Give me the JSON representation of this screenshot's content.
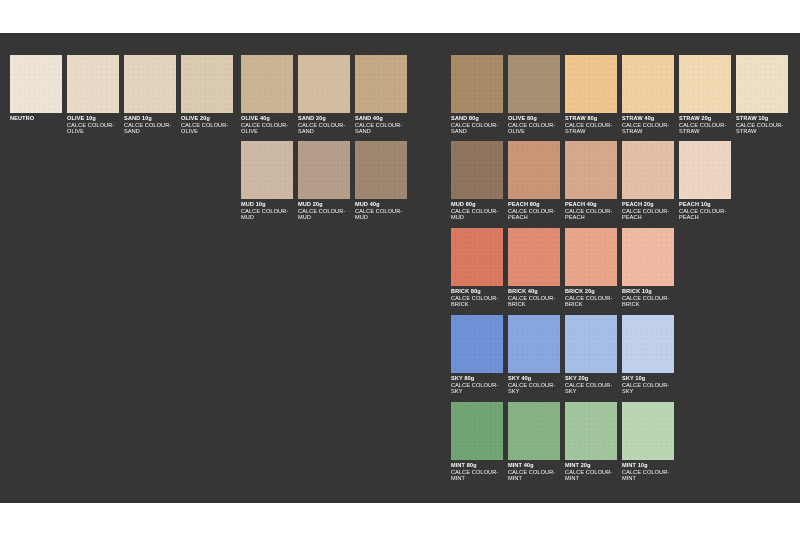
{
  "swatches_left": [
    {
      "title": "NEUTRO",
      "line2": "",
      "line3": "",
      "color": "#eee4d6"
    },
    {
      "title": "OLIVE 10g",
      "line2": "CALCE COLOUR-",
      "line3": "OLIVE",
      "color": "#e7dac6"
    },
    {
      "title": "SAND 10g",
      "line2": "CALCE COLOUR-",
      "line3": "SAND",
      "color": "#e3d3bf"
    },
    {
      "title": "OLIVE 20g",
      "line2": "CALCE COLOUR-",
      "line3": "OLIVE",
      "color": "#dacaaf"
    },
    {
      "title": "OLIVE 40g",
      "line2": "CALCE COLOUR-",
      "line3": "OLIVE",
      "color": "#c9b494"
    },
    {
      "title": "SAND 20g",
      "line2": "CALCE COLOUR-",
      "line3": "SAND",
      "color": "#d3bd9e"
    },
    {
      "title": "SAND 40g",
      "line2": "CALCE COLOUR-",
      "line3": "SAND",
      "color": "#c4a884"
    },
    {
      "title": "MUD 10g",
      "line2": "CALCE COLOUR-",
      "line3": "MUD",
      "color": "#ccb8a3"
    },
    {
      "title": "MUD 20g",
      "line2": "CALCE COLOUR-",
      "line3": "MUD",
      "color": "#b49e89"
    },
    {
      "title": "MUD 40g",
      "line2": "CALCE COLOUR-",
      "line3": "MUD",
      "color": "#9e8670"
    }
  ],
  "swatches_right": [
    {
      "title": "SAND 80g",
      "line2": "CALCE COLOUR-",
      "line3": "SAND",
      "color": "#a88965"
    },
    {
      "title": "OLIVE 80g",
      "line2": "CALCE COLOUR-",
      "line3": "OLIVE",
      "color": "#a69073"
    },
    {
      "title": "STRAW 80g",
      "line2": "CALCE COLOUR-",
      "line3": "STRAW",
      "color": "#efc58e"
    },
    {
      "title": "STRAW 40g",
      "line2": "CALCE COLOUR-",
      "line3": "STRAW",
      "color": "#f1cf9e"
    },
    {
      "title": "STRAW 20g",
      "line2": "CALCE COLOUR-",
      "line3": "STRAW",
      "color": "#f1d9b2"
    },
    {
      "title": "STRAW 10g",
      "line2": "CALCE COLOUR-",
      "line3": "STRAW",
      "color": "#ede0c6"
    },
    {
      "title": "MUD 80g",
      "line2": "CALCE COLOUR-",
      "line3": "MUD",
      "color": "#8e735d"
    },
    {
      "title": "PEACH 80g",
      "line2": "CALCE COLOUR-",
      "line3": "PEACH",
      "color": "#c99576"
    },
    {
      "title": "PEACH 40g",
      "line2": "CALCE COLOUR-",
      "line3": "PEACH",
      "color": "#d6a88b"
    },
    {
      "title": "PEACH 20g",
      "line2": "CALCE COLOUR-",
      "line3": "PEACH",
      "color": "#e3bfa5"
    },
    {
      "title": "PEACH 10g",
      "line2": "CALCE COLOUR-",
      "line3": "PEACH",
      "color": "#ecd5c2"
    },
    {
      "title": "BRICK 80g",
      "line2": "CALCE COLOUR-",
      "line3": "BRICK",
      "color": "#d9785e"
    },
    {
      "title": "BRICK 40g",
      "line2": "CALCE COLOUR-",
      "line3": "BRICK",
      "color": "#e08b70"
    },
    {
      "title": "BRICK 20g",
      "line2": "CALCE COLOUR-",
      "line3": "BRICK",
      "color": "#e9a388"
    },
    {
      "title": "BRICK 10g",
      "line2": "CALCE COLOUR-",
      "line3": "BRICK",
      "color": "#f0b9a2"
    },
    {
      "title": "SKY 80g",
      "line2": "CALCE COLOUR-",
      "line3": "SKY",
      "color": "#6e90d6"
    },
    {
      "title": "SKY 40g",
      "line2": "CALCE COLOUR-",
      "line3": "SKY",
      "color": "#87a5df"
    },
    {
      "title": "SKY 20g",
      "line2": "CALCE COLOUR-",
      "line3": "SKY",
      "color": "#a6bde6"
    },
    {
      "title": "SKY 10g",
      "line2": "CALCE COLOUR-",
      "line3": "SKY",
      "color": "#c0d0ec"
    },
    {
      "title": "MINT 80g",
      "line2": "CALCE COLOUR-",
      "line3": "MINT",
      "color": "#70a472"
    },
    {
      "title": "MINT 40g",
      "line2": "CALCE COLOUR-",
      "line3": "MINT",
      "color": "#85b283"
    },
    {
      "title": "MINT 20g",
      "line2": "CALCE COLOUR-",
      "line3": "MINT",
      "color": "#a1c59c"
    },
    {
      "title": "MINT 10g",
      "line2": "CALCE COLOUR-",
      "line3": "MINT",
      "color": "#b9d6b2"
    }
  ]
}
